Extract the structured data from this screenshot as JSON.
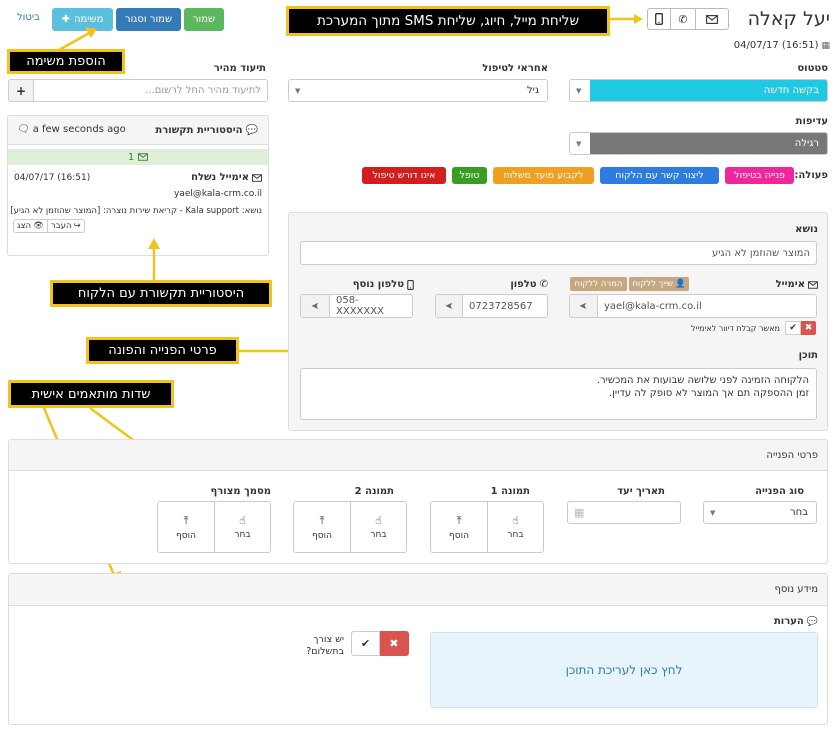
{
  "header": {
    "contact_name": "יעל קאלה",
    "date": "04/07/17 (16:51)",
    "buttons": {
      "cancel": "ביטול",
      "task": "משימה",
      "save_close": "שמור וסגור",
      "save": "שמור"
    }
  },
  "callouts": {
    "top": "שליחת מייל, חיוג, שליחת SMS מתוך המערכת",
    "add_task": "הוספת משימה",
    "history": "היסטוריית תקשורת עם הלקוח",
    "details": "פרטי הפנייה והפונה",
    "custom": "שדות מותאמים אישית"
  },
  "quick_note": {
    "label": "תיעוד מהיר",
    "placeholder": "לתיעוד מהיר החל לרשום...",
    "add_symbol": "+"
  },
  "responsible": {
    "label": "אחראי לטיפול",
    "value": "גיל"
  },
  "status": {
    "label": "סטטוס",
    "value": "בקשה חדשה",
    "color": "#1fc8e3"
  },
  "priority": {
    "label": "עדיפות",
    "value": "רגילה",
    "color": "#777777"
  },
  "history": {
    "title": "היסטוריית תקשורת",
    "time": "a few seconds ago",
    "count": "1",
    "item_title": "אימייל נשלח",
    "item_date": "04/07/17 (16:51)",
    "item_email": "yael@kala-crm.co.il",
    "item_subject": "נושא: Kala support - קריאת שירות נוצרה: [המוצר שהוזמן לא הגיע]",
    "forward": "העבר",
    "view": "הצג"
  },
  "actions": {
    "label": "פעולה:",
    "items": [
      {
        "text": "פנייה בטיפול",
        "color": "#f0269c"
      },
      {
        "text": "ליצור קשר עם הלקוח",
        "color": "#2d7de0"
      },
      {
        "text": "לקבוע מועד משלוח",
        "color": "#f0a020"
      },
      {
        "text": "טופל",
        "color": "#3a9d23"
      },
      {
        "text": "אינו דורש טיפול",
        "color": "#d21e1e"
      }
    ]
  },
  "form": {
    "subject_label": "נושא",
    "subject_value": "המוצר שהוזמן לא הגיע",
    "email_label": "אימייל",
    "email_value": "yael@kala-crm.co.il",
    "assign_customer": "שייך ללקוח",
    "convert_customer": "המרה ללקוח",
    "phone_label": "טלפון",
    "phone_value": "0723728567",
    "phone2_label": "טלפון נוסף",
    "phone2_value": "058-XXXXXXX",
    "mailing_consent": "מאשר קבלת דיוור לאימייל",
    "content_label": "תוכן",
    "content_line1": "הלקוחה הזמינה לפני שלושה שבועות את המכשיר.",
    "content_line2": "זמן ההספקה תם אך המוצר לא סופק לה עדיין."
  },
  "inquiry_details": {
    "title": "פרטי הפנייה",
    "type_label": "סוג הפנייה",
    "type_value": "בחר",
    "due_label": "תאריך יעד",
    "image1_label": "תמונה 1",
    "image2_label": "תמונה 2",
    "attachment_label": "מסמך מצורף",
    "choose": "בחר",
    "add": "הוסף"
  },
  "extra_info": {
    "title": "מידע נוסף",
    "notes_label": "הערות",
    "notes_placeholder": "לחץ כאן לעריכת התוכן",
    "payment_label_1": "יש צורך",
    "payment_label_2": "בתשלום?"
  }
}
